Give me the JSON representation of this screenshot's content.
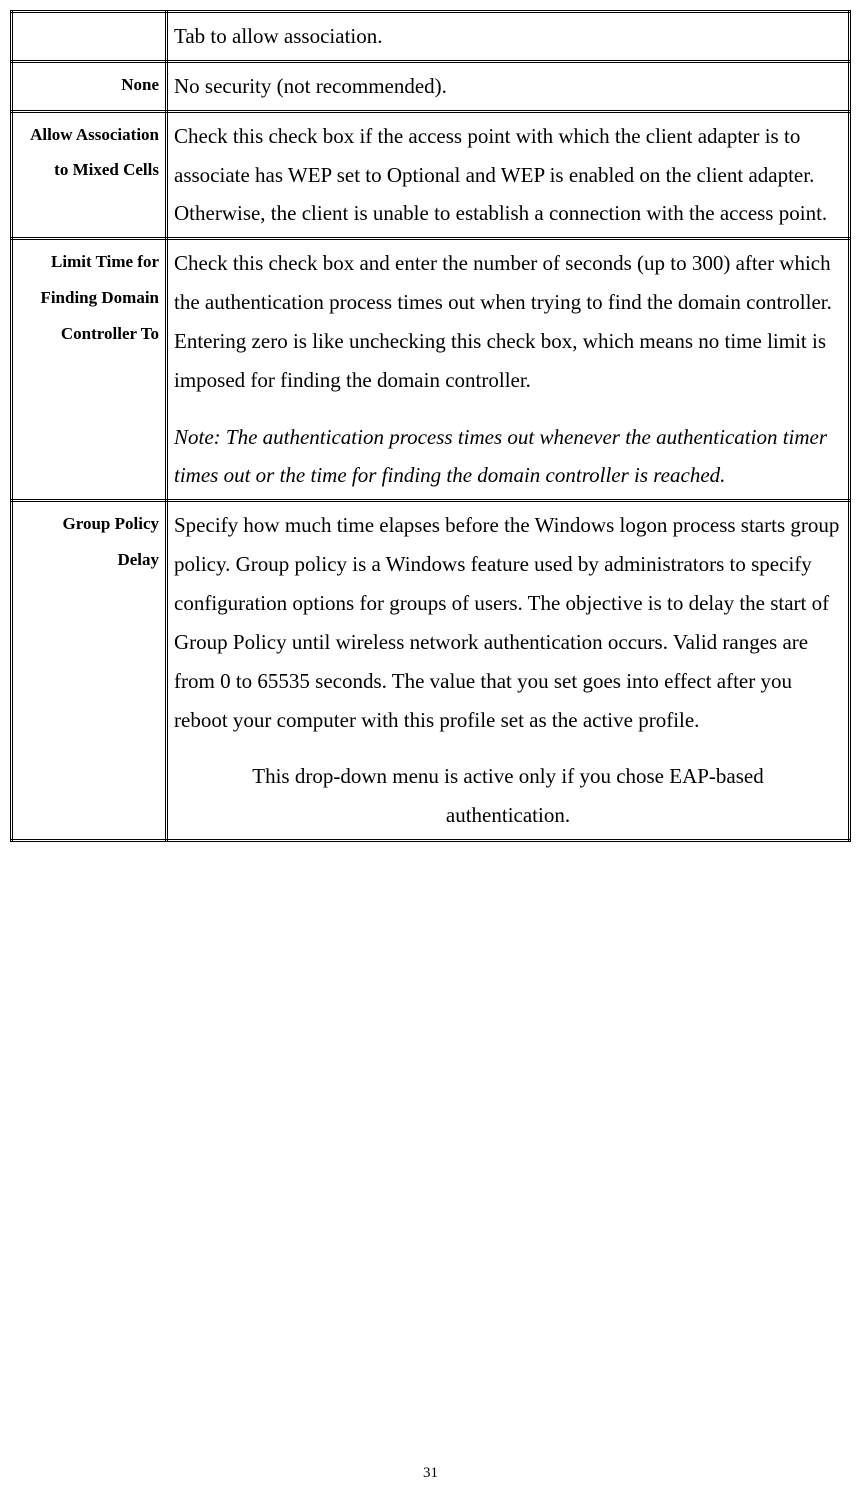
{
  "rows": [
    {
      "label": "",
      "desc": "Tab to allow association.",
      "doubleBorder": true
    },
    {
      "label": "None",
      "desc": "No security (not recommended).",
      "doubleBorder": false
    },
    {
      "label": "Allow Association to Mixed Cells",
      "desc": "Check this check box if the access point with which the client adapter is to associate has WEP set to Optional and WEP is enabled on the client adapter. Otherwise, the client is unable to establish a connection with the access point.",
      "doubleBorder": true
    },
    {
      "label": "Limit Time for Finding Domain Controller To",
      "desc": "Check this check box and enter the number of seconds (up to 300) after which the authentication process times out when trying to find the domain controller. Entering zero is like unchecking this check box, which means no time limit is imposed for finding the domain controller.",
      "note": "Note: The authentication process times out whenever the authentication timer times out or the time for finding the domain controller is reached.",
      "doubleBorder": false
    },
    {
      "label": "Group Policy Delay",
      "desc": "Specify how much time elapses before the Windows logon process starts group policy. Group policy is a Windows feature used by administrators to specify configuration options for groups of users. The objective is to delay the start of Group Policy until wireless network authentication occurs. Valid ranges are from 0 to 65535 seconds. The value that you set goes into effect after you reboot your computer with this profile set as the active profile.",
      "centeredNote": "This drop-down menu is active only if you chose EAP-based authentication.",
      "doubleBorder": false
    }
  ],
  "pageNumber": "31"
}
